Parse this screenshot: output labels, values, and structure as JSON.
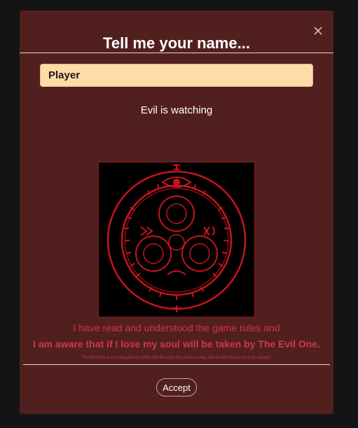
{
  "modal": {
    "title": "Tell me your name...",
    "close_icon": "close-icon",
    "name_input": {
      "value": "Player",
      "placeholder": ""
    },
    "subtitle": "Evil is watching",
    "image": {
      "description_icon": "halo-of-the-sun-seal"
    },
    "terms": {
      "line1": "I have read and understood the game rules and",
      "line2": "I am aware that if I lose my soul will be taken by The Evil One.",
      "fine_print": "The Evil One is not obligated to fulfill with the wish the obvious way, will decide how to do it by oneself."
    },
    "accept_label": "Accept"
  },
  "colors": {
    "page_background": "#141414",
    "modal_background": "#521f1f",
    "input_background": "#ffdba8",
    "terms_text": "#d0364a",
    "seal_red": "#c8141e"
  }
}
